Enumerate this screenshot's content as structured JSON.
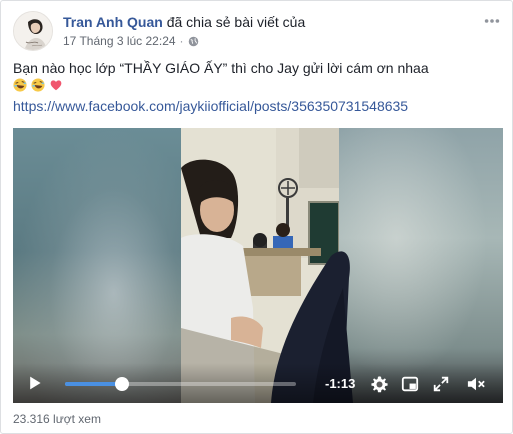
{
  "post": {
    "author": "Tran Anh Quan",
    "action": "đã chia sẻ bài viết của",
    "timestamp": "17 Tháng 3 lúc 22:24",
    "separator": "·",
    "audience_icon": "globe-icon",
    "more_icon": "more-options-icon",
    "text_line1": "Bạn nào học lớp “THẦY GIÁO ẤY” thì cho Jay gửi lời cám ơn nhaa",
    "emojis": [
      "rolling-on-floor-laughing",
      "rolling-on-floor-laughing",
      "heart"
    ],
    "link": "https://www.facebook.com/jaykiiofficial/posts/356350731548635"
  },
  "video": {
    "progress": 0.245,
    "time_remaining": "-1:13",
    "icons": {
      "play": "play-icon",
      "settings": "gear-icon",
      "pip": "picture-in-picture-icon",
      "fullscreen": "fullscreen-icon",
      "volume": "volume-muted-icon"
    },
    "accent_color": "#4a90e2"
  },
  "footer": {
    "views": "23.316 lượt xem"
  },
  "colors": {
    "link": "#365899",
    "text": "#1d2129",
    "meta": "#616770"
  }
}
